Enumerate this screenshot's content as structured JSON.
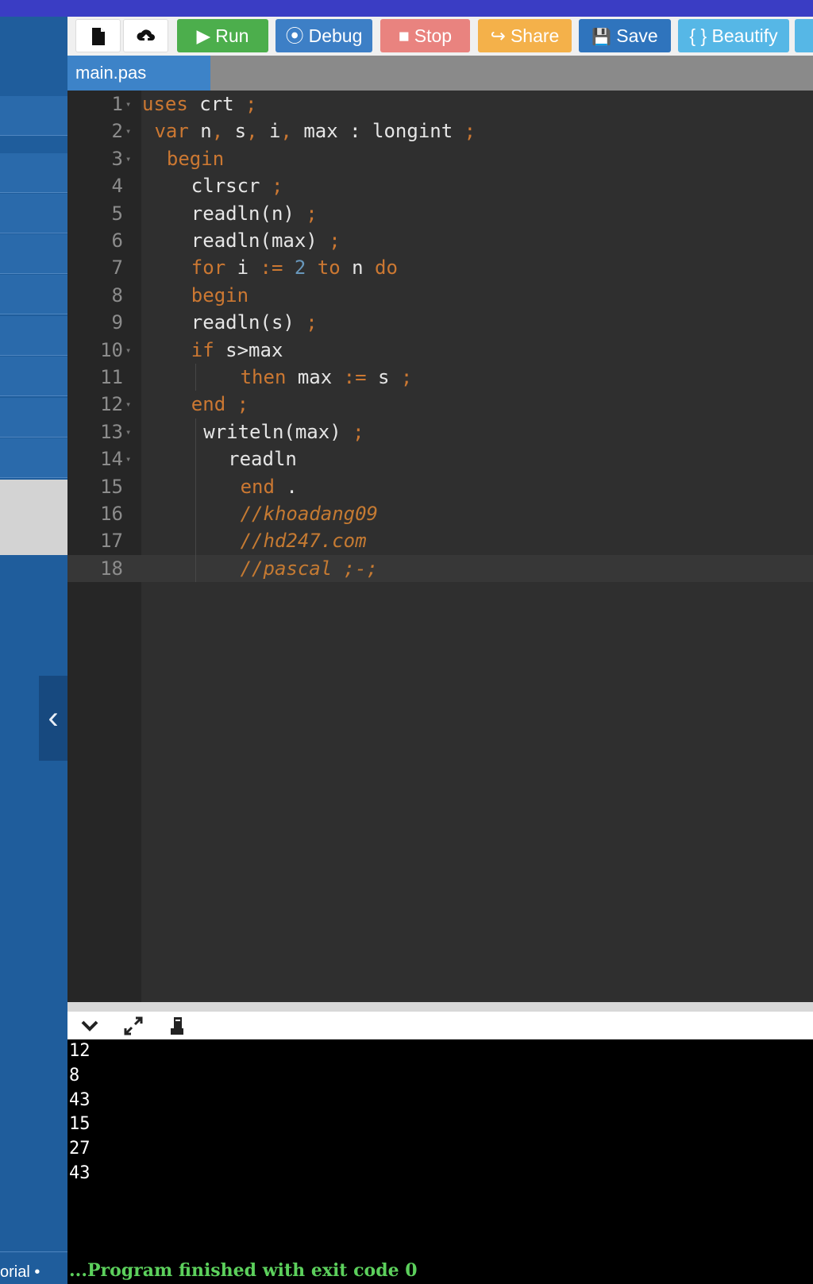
{
  "toolbar": {
    "new_file_icon": "file-icon",
    "upload_icon": "upload-icon",
    "buttons": [
      {
        "label": "Run",
        "icon": "▶",
        "color": "#4cae4c"
      },
      {
        "label": "Debug",
        "icon": "⦿",
        "color": "#3d7fc6"
      },
      {
        "label": "Stop",
        "icon": "■",
        "color": "#e9837f"
      },
      {
        "label": "Share",
        "icon": "↪",
        "color": "#f4b14a"
      },
      {
        "label": "Save",
        "icon": "💾",
        "color": "#2f74bd"
      },
      {
        "label": "{ } Beautify",
        "icon": "",
        "color": "#56b7e6"
      }
    ]
  },
  "tabs": [
    {
      "label": "main.pas",
      "active": true
    }
  ],
  "editor": {
    "language": "pascal",
    "active_line": 18,
    "lines": [
      {
        "n": "1",
        "fold": true,
        "indent": 0,
        "tokens": [
          [
            "kw",
            "uses"
          ],
          [
            "id",
            " crt"
          ],
          [
            "kw",
            " ;"
          ]
        ]
      },
      {
        "n": "2",
        "fold": true,
        "indent": 1,
        "tokens": [
          [
            "kw",
            "var"
          ],
          [
            "id",
            " n"
          ],
          [
            "kw",
            ","
          ],
          [
            "id",
            " s"
          ],
          [
            "kw",
            ","
          ],
          [
            "id",
            " i"
          ],
          [
            "kw",
            ","
          ],
          [
            "id",
            " max : longint"
          ],
          [
            "kw",
            " ;"
          ]
        ]
      },
      {
        "n": "3",
        "fold": true,
        "indent": 2,
        "tokens": [
          [
            "kw",
            "begin"
          ]
        ]
      },
      {
        "n": "4",
        "fold": false,
        "indent": 4,
        "tokens": [
          [
            "id",
            "clrscr"
          ],
          [
            "kw",
            " ;"
          ]
        ]
      },
      {
        "n": "5",
        "fold": false,
        "indent": 4,
        "tokens": [
          [
            "id",
            "readln(n)"
          ],
          [
            "kw",
            " ;"
          ]
        ]
      },
      {
        "n": "6",
        "fold": false,
        "indent": 4,
        "tokens": [
          [
            "id",
            "readln(max)"
          ],
          [
            "kw",
            " ;"
          ]
        ]
      },
      {
        "n": "7",
        "fold": false,
        "indent": 4,
        "tokens": [
          [
            "kw",
            "for"
          ],
          [
            "id",
            " i"
          ],
          [
            "kw",
            " :="
          ],
          [
            "num",
            " 2"
          ],
          [
            "kw",
            " to"
          ],
          [
            "id",
            " n"
          ],
          [
            "kw",
            " do"
          ]
        ]
      },
      {
        "n": "8",
        "fold": false,
        "indent": 4,
        "tokens": [
          [
            "kw",
            "begin"
          ]
        ]
      },
      {
        "n": "9",
        "fold": false,
        "indent": 4,
        "tokens": [
          [
            "id",
            "readln(s)"
          ],
          [
            "kw",
            " ;"
          ]
        ]
      },
      {
        "n": "10",
        "fold": true,
        "indent": 4,
        "tokens": [
          [
            "kw",
            "if"
          ],
          [
            "id",
            " s>max"
          ]
        ]
      },
      {
        "n": "11",
        "fold": false,
        "indent": 8,
        "guide": true,
        "tokens": [
          [
            "kw",
            "then"
          ],
          [
            "id",
            " max"
          ],
          [
            "kw",
            " :="
          ],
          [
            "id",
            " s"
          ],
          [
            "kw",
            " ;"
          ]
        ]
      },
      {
        "n": "12",
        "fold": true,
        "indent": 4,
        "tokens": [
          [
            "kw",
            "end"
          ],
          [
            "kw",
            " ;"
          ]
        ]
      },
      {
        "n": "13",
        "fold": true,
        "indent": 5,
        "guide": true,
        "tokens": [
          [
            "id",
            "writeln(max)"
          ],
          [
            "kw",
            " ;"
          ]
        ]
      },
      {
        "n": "14",
        "fold": true,
        "indent": 7,
        "guide": true,
        "tokens": [
          [
            "id",
            "readln"
          ]
        ]
      },
      {
        "n": "15",
        "fold": false,
        "indent": 8,
        "guide": true,
        "tokens": [
          [
            "kw",
            "end"
          ],
          [
            "id",
            " ."
          ]
        ]
      },
      {
        "n": "16",
        "fold": false,
        "indent": 8,
        "guide": true,
        "tokens": [
          [
            "cm",
            "//khoadang09"
          ]
        ]
      },
      {
        "n": "17",
        "fold": false,
        "indent": 8,
        "guide": true,
        "tokens": [
          [
            "cm",
            "//hd247.com"
          ]
        ]
      },
      {
        "n": "18",
        "fold": false,
        "indent": 8,
        "guide": true,
        "tokens": [
          [
            "cm",
            "//pascal ;-;"
          ]
        ]
      }
    ]
  },
  "console": {
    "icons": [
      "chevron-down-icon",
      "expand-icon",
      "clear-icon"
    ],
    "output": [
      "12",
      "8",
      "43",
      "15",
      "27",
      "43"
    ],
    "finish_message": "...Program finished with exit code 0"
  },
  "sidebar": {
    "collapse_icon": "‹",
    "footer_text": "orial •"
  }
}
